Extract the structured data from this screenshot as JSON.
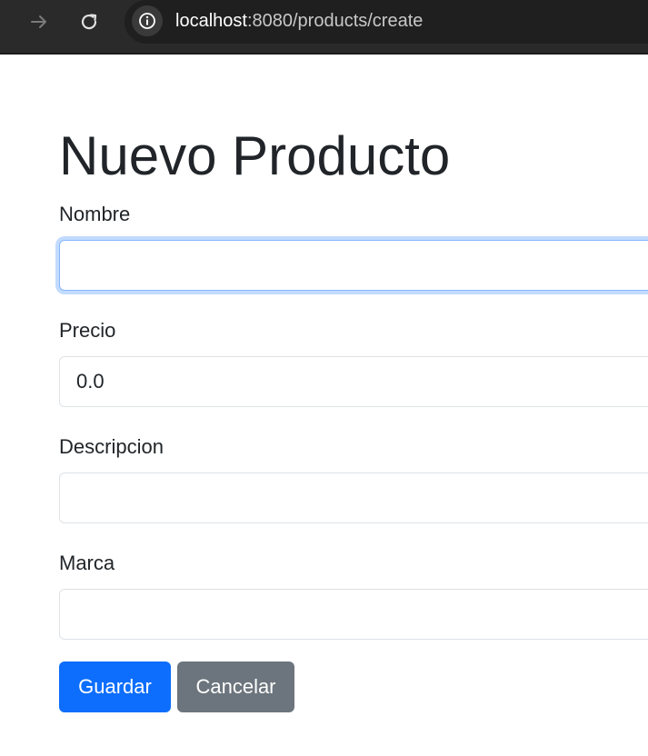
{
  "browser": {
    "url_host": "localhost",
    "url_path": ":8080/products/create",
    "icons": [
      "forward-icon",
      "reload-icon",
      "info-icon"
    ]
  },
  "page": {
    "title": "Nuevo Producto"
  },
  "form": {
    "nombre": {
      "label": "Nombre",
      "value": ""
    },
    "precio": {
      "label": "Precio",
      "value": "0.0"
    },
    "descripcion": {
      "label": "Descripcion",
      "value": ""
    },
    "marca": {
      "label": "Marca",
      "value": ""
    }
  },
  "actions": {
    "save_label": "Guardar",
    "cancel_label": "Cancelar"
  },
  "colors": {
    "primary": "#0d6efd",
    "secondary": "#6c757d",
    "focus_border": "#86b7fe",
    "text": "#212529"
  }
}
